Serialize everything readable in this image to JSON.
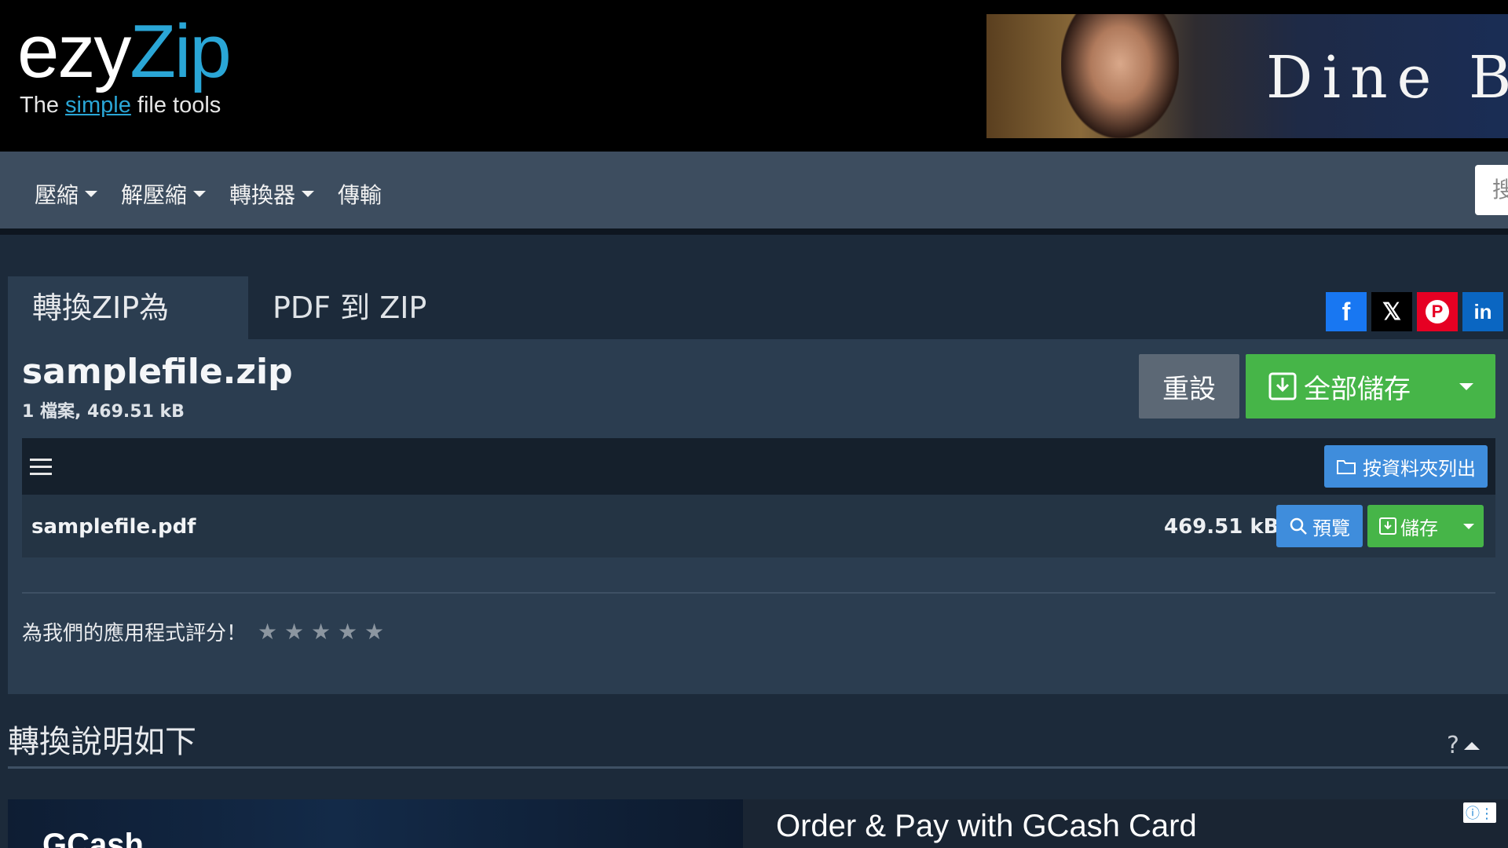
{
  "header": {
    "logo_main_a": "ezy",
    "logo_main_b": "Zip",
    "logo_tag_a": "The ",
    "logo_tag_b": "simple",
    "logo_tag_c": " file tools",
    "ad_text": "Dine Be"
  },
  "nav": {
    "items": [
      {
        "label": "壓縮",
        "has_caret": true
      },
      {
        "label": "解壓縮",
        "has_caret": true
      },
      {
        "label": "轉換器",
        "has_caret": true
      },
      {
        "label": "傳輸",
        "has_caret": false
      }
    ],
    "search_placeholder": "搜"
  },
  "tabs": {
    "active": "轉換ZIP為PDF",
    "inactive": "PDF 到 ZIP"
  },
  "social": [
    {
      "name": "facebook",
      "glyph": "f",
      "color": "#1877f2"
    },
    {
      "name": "x",
      "glyph": "𝕏",
      "color": "#000000"
    },
    {
      "name": "pinterest",
      "glyph": "P",
      "color": "#e60023"
    },
    {
      "name": "linkedin",
      "glyph": "in",
      "color": "#0a66c2"
    }
  ],
  "archive": {
    "filename": "samplefile.zip",
    "info": "1 檔案, 469.51 kB",
    "reset_label": "重設",
    "save_all_label": "全部儲存"
  },
  "file_list": {
    "folder_button": "按資料夾列出",
    "rows": [
      {
        "name": "samplefile.pdf",
        "size": "469.51 kB",
        "preview_label": "預覽",
        "save_label": "儲存"
      }
    ]
  },
  "rating": {
    "prompt": "為我們的應用程式評分！",
    "stars": "★ ★ ★ ★ ★",
    "value": 0,
    "max": 5
  },
  "how": {
    "title": "轉換說明如下",
    "toggle": "?"
  },
  "ad_bottom": {
    "brand": "GCash",
    "title": "Order & Pay with GCash Card"
  },
  "colors": {
    "accent_blue": "#3f8ddc",
    "accent_green": "#46b548",
    "brand_cyan": "#2aa6d6"
  }
}
